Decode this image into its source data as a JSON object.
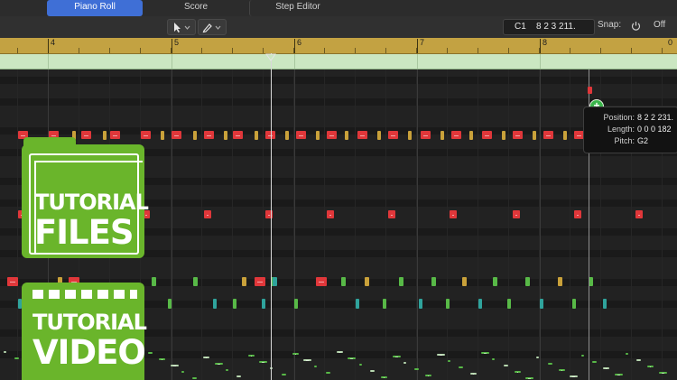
{
  "tabs": {
    "piano_roll": "Piano Roll",
    "score": "Score",
    "step_editor": "Step Editor"
  },
  "toolbar": {
    "pointer_tool": "pointer-icon",
    "pencil_tool": "pencil-icon",
    "position_track": "C1",
    "position_value": "8 2 3 211.",
    "snap_label": "Snap:",
    "snap_value": "Off",
    "right_edge_label": "0"
  },
  "ruler": {
    "bars": [
      "4",
      "5",
      "6",
      "7",
      "8"
    ]
  },
  "tooltip": {
    "position_label": "Position:",
    "position_value": "8 2 2 231.",
    "length_label": "Length:",
    "length_value": "0 0 0 182",
    "pitch_label": "Pitch:",
    "pitch_value": "G2"
  },
  "overlay": {
    "files_line1": "TUTORIAL",
    "files_line2": "FILES",
    "video_line1": "TUTORIAL",
    "video_line2": "VIDEO"
  },
  "colors": {
    "active_tab": "#3f6fd6",
    "ruler": "#c3a242",
    "region": "#cbe7c2",
    "note_red": "#e0373a",
    "note_yellow": "#c9a13a",
    "note_green": "#58b947",
    "note_teal": "#2fa39c",
    "badge_green": "#6ab52b",
    "add_icon": "#39b54a"
  }
}
